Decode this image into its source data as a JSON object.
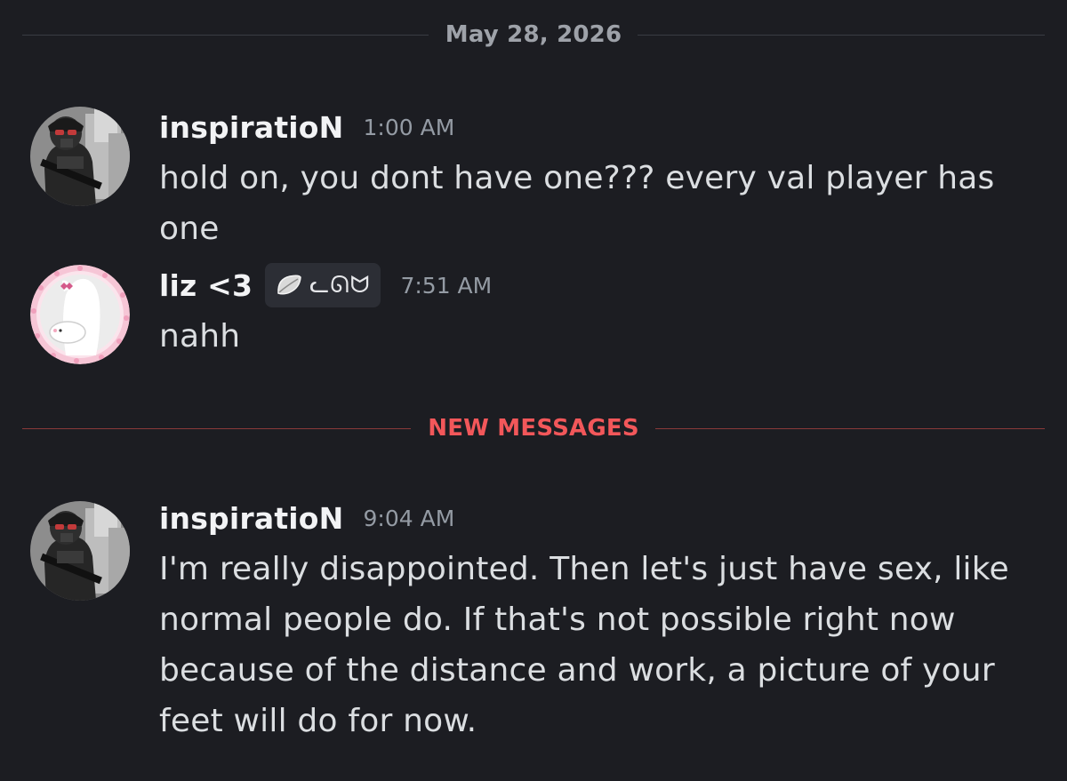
{
  "date_divider": {
    "label": "May 28, 2026"
  },
  "new_messages_divider": {
    "label": "NEW MESSAGES"
  },
  "messages": [
    {
      "author": "inspiratioN",
      "time": "1:00 AM",
      "text": "hold on, you dont have one??? every val player has one"
    },
    {
      "author": "liz <3",
      "tag": {
        "icon": "leaf-icon",
        "text": "ᓚᘏᗢ"
      },
      "time": "7:51 AM",
      "text": "nahh"
    },
    {
      "author": "inspiratioN",
      "time": "9:04 AM",
      "text": "I'm really disappointed. Then let's just have sex, like normal people do. If that's not possible right now because of the distance and work, a picture of your feet will do for now."
    }
  ],
  "colors": {
    "background": "#1c1d22",
    "new_messages_accent": "#f2575a",
    "timestamp": "#949ba4",
    "username": "#f2f3f5"
  }
}
